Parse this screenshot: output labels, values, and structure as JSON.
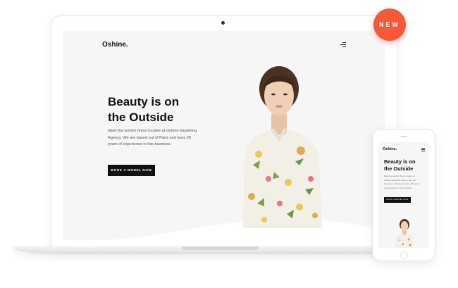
{
  "badge": {
    "label": "NEW",
    "color": "#f5593a"
  },
  "desktop": {
    "logo": "Oshine.",
    "menu_icon": "hamburger-menu-icon",
    "hero": {
      "title_line1": "Beauty is on",
      "title_line2": "the Outside",
      "description": "Meet the world's finest models at Oshine Modelling Agency. We are based out of Paris and have 25 years of experience in this business.",
      "cta_label": "BOOK A MODEL NOW"
    }
  },
  "mobile": {
    "logo": "Oshine.",
    "menu_icon": "hamburger-menu-icon",
    "hero": {
      "title_line1": "Beauty is on",
      "title_line2": "the Outside",
      "description": "Meet the world's finest models at Oshine Modelling Agency. We are based out of Paris and have 25 years of experience in this business.",
      "cta_label": "BOOK A MODEL NOW"
    }
  }
}
